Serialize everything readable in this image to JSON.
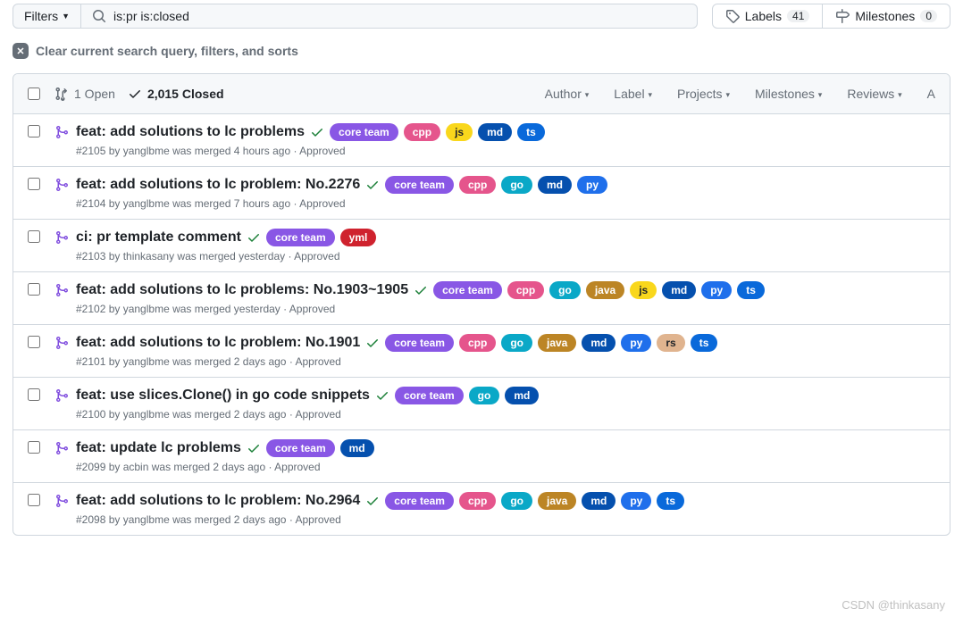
{
  "filters_label": "Filters",
  "search_value": "is:pr is:closed",
  "labels_btn": "Labels",
  "labels_count": "41",
  "milestones_btn": "Milestones",
  "milestones_count": "0",
  "clear_text": "Clear current search query, filters, and sorts",
  "open_count": "1 Open",
  "closed_count": "2,015 Closed",
  "dropdowns": {
    "author": "Author",
    "label": "Label",
    "projects": "Projects",
    "milestones": "Milestones",
    "reviews": "Reviews",
    "assignee": "A"
  },
  "label_names": {
    "coreteam": "core team",
    "cpp": "cpp",
    "js": "js",
    "md": "md",
    "ts": "ts",
    "go": "go",
    "py": "py",
    "yml": "yml",
    "java": "java",
    "rs": "rs"
  },
  "rows": [
    {
      "title": "feat: add solutions to lc problems",
      "meta": "#2105 by yanglbme was merged 4 hours ago · Approved",
      "labels": [
        "coreteam",
        "cpp",
        "js",
        "md",
        "ts"
      ]
    },
    {
      "title": "feat: add solutions to lc problem: No.2276",
      "meta": "#2104 by yanglbme was merged 7 hours ago · Approved",
      "labels": [
        "coreteam",
        "cpp",
        "go",
        "md",
        "py"
      ]
    },
    {
      "title": "ci: pr template comment",
      "meta": "#2103 by thinkasany was merged yesterday · Approved",
      "labels": [
        "coreteam",
        "yml"
      ]
    },
    {
      "title": "feat: add solutions to lc problems: No.1903~1905",
      "meta": "#2102 by yanglbme was merged yesterday · Approved",
      "labels": [
        "coreteam",
        "cpp",
        "go",
        "java",
        "js",
        "md",
        "py",
        "ts"
      ]
    },
    {
      "title": "feat: add solutions to lc problem: No.1901",
      "meta": "#2101 by yanglbme was merged 2 days ago · Approved",
      "labels": [
        "coreteam",
        "cpp",
        "go",
        "java",
        "md",
        "py",
        "rs",
        "ts"
      ]
    },
    {
      "title": "feat: use slices.Clone() in go code snippets",
      "meta": "#2100 by yanglbme was merged 2 days ago · Approved",
      "labels": [
        "coreteam",
        "go",
        "md"
      ]
    },
    {
      "title": "feat: update lc problems",
      "meta": "#2099 by acbin was merged 2 days ago · Approved",
      "labels": [
        "coreteam",
        "md"
      ]
    },
    {
      "title": "feat: add solutions to lc problem: No.2964",
      "meta": "#2098 by yanglbme was merged 2 days ago · Approved",
      "labels": [
        "coreteam",
        "cpp",
        "go",
        "java",
        "md",
        "py",
        "ts"
      ]
    }
  ],
  "watermark": "CSDN @thinkasany"
}
